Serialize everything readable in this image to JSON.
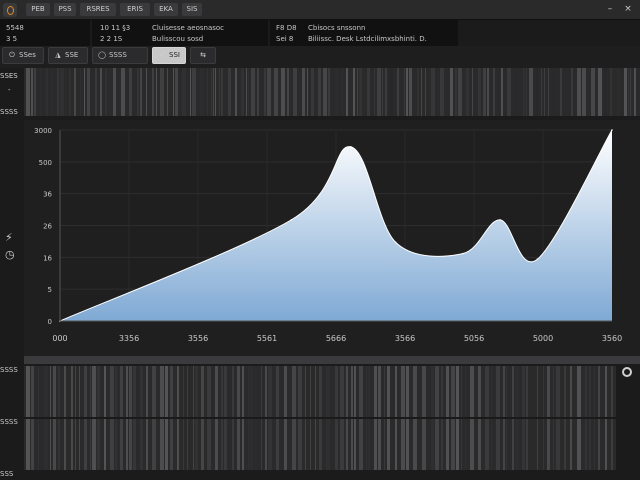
{
  "menu": {
    "items": [
      "PEB",
      "PSS",
      "RSRES",
      "ERIS",
      "EKA",
      "SIS"
    ]
  },
  "window": {
    "minimize": "–",
    "close": "×"
  },
  "info": {
    "left": [
      "5548",
      "3 5"
    ],
    "middle_keys": [
      "10  11  §3",
      "2  2  1S"
    ],
    "middle_vals": [
      "Cluisesse   aeosnasoc",
      "Bulisscou    sosd"
    ],
    "right_keys": [
      "F8  D8",
      "Sei  8"
    ],
    "right_vals": [
      "Cbisocs   snssonn",
      "Biliissc.    Desk    Lstdcilimxsbhinti.  D."
    ]
  },
  "toolbar": {
    "buttons": [
      {
        "icon": "⏻",
        "label": "SSes"
      },
      {
        "icon": "◮",
        "label": "SSE"
      },
      {
        "icon": "◯",
        "label": "SSSS"
      },
      {
        "icon": "✓",
        "label": "SSI"
      },
      {
        "icon": "⇆",
        "label": ""
      }
    ]
  },
  "left_strip": {
    "top": "SSES",
    "middle": "SSSS",
    "dash": "-",
    "tool_icon": "⚡",
    "clock_icon": "◷"
  },
  "chart_data": {
    "type": "area",
    "title": "",
    "xlabel": "",
    "ylabel": "",
    "x": [
      0,
      3100,
      3900,
      4500,
      5400,
      5900,
      6400,
      7400
    ],
    "y": [
      0,
      1800,
      3100,
      1400,
      1200,
      1800,
      1100,
      3400
    ],
    "xticks": [
      "000",
      "3356",
      "3556",
      "5561",
      "5666",
      "3566",
      "5056",
      "5000",
      "3560"
    ],
    "yticks": [
      "0",
      "5",
      "16",
      "26",
      "36",
      "500",
      "3000"
    ],
    "ylim": [
      0,
      3400
    ],
    "grid": true,
    "fill_top": "#ffffff",
    "fill_bottom": "#7fa9d4"
  },
  "bottom_labels": [
    "SSSS",
    "SSSS",
    "SSS"
  ]
}
